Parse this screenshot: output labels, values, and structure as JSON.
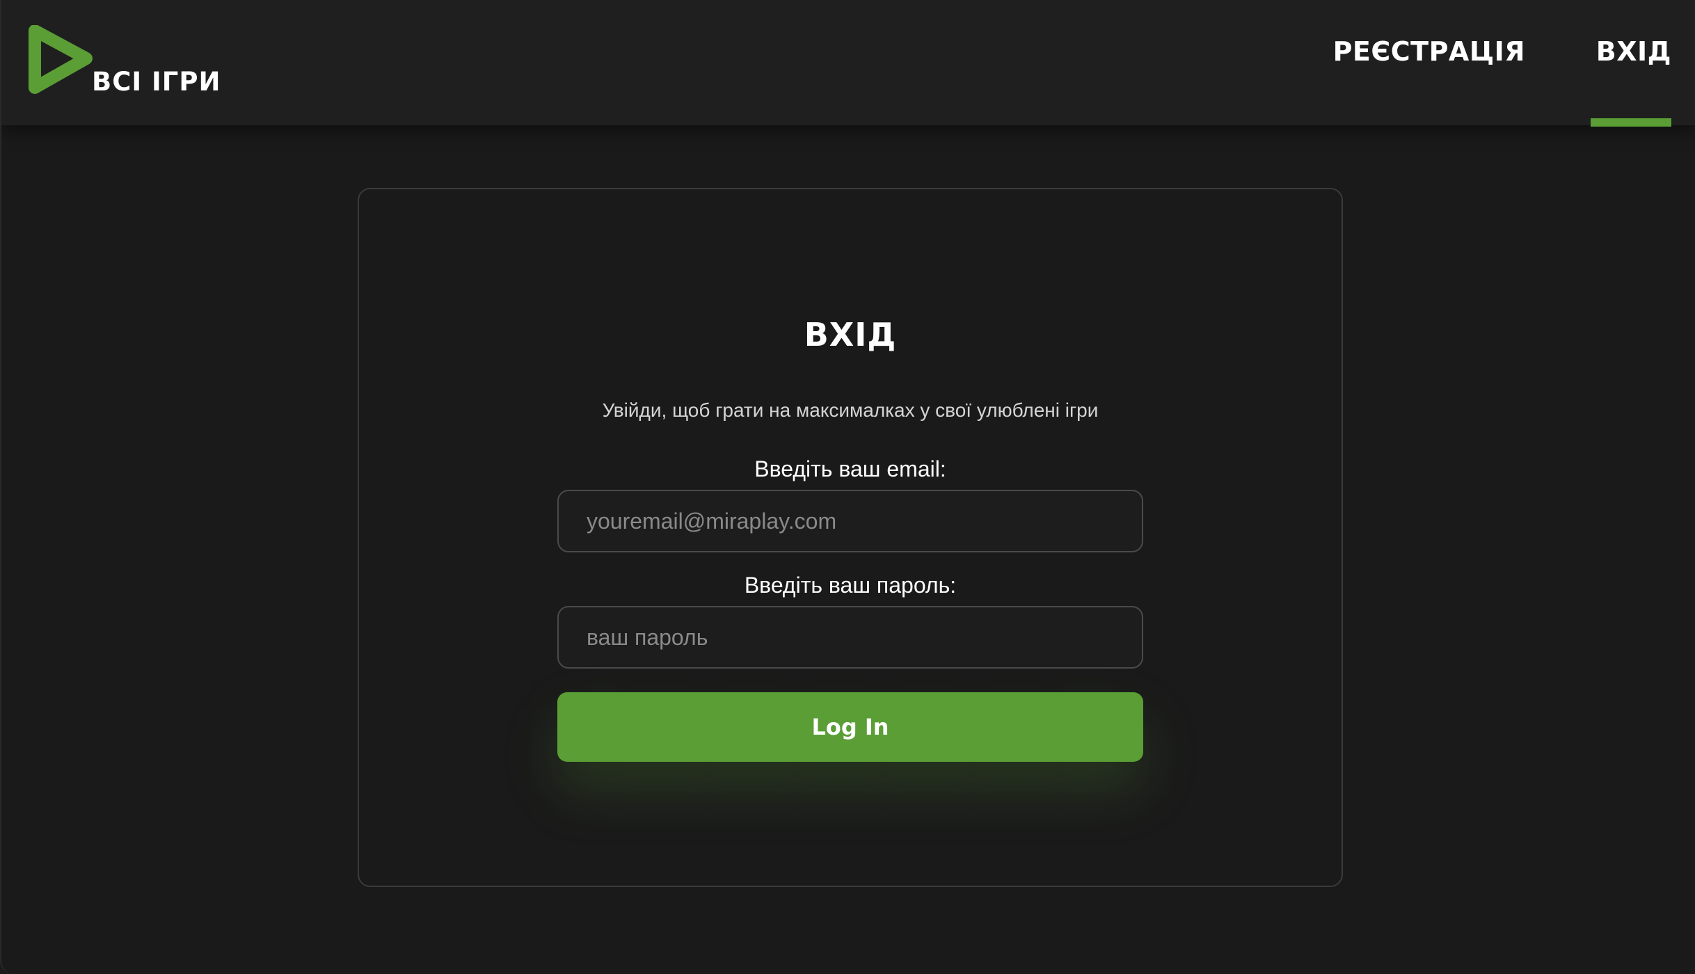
{
  "header": {
    "logo_text": "ВСІ ІГРИ",
    "nav": {
      "register_label": "РЕЄСТРАЦІЯ",
      "login_label": "ВХІД",
      "active": "login"
    }
  },
  "login_form": {
    "title": "ВХІД",
    "subtitle": "Увійди, щоб грати на максималках у свої улюблені ігри",
    "email_label": "Введіть ваш email:",
    "email_placeholder": "youremail@miraplay.com",
    "email_value": "",
    "password_label": "Введіть ваш пароль:",
    "password_placeholder": "ваш пароль",
    "password_value": "",
    "submit_label": "Log In"
  },
  "colors": {
    "accent": "#5a9e35",
    "background": "#1a1a1a",
    "header_background": "#1f1f1f",
    "text": "#ffffff"
  },
  "icons": {
    "logo": "play-triangle-icon"
  }
}
